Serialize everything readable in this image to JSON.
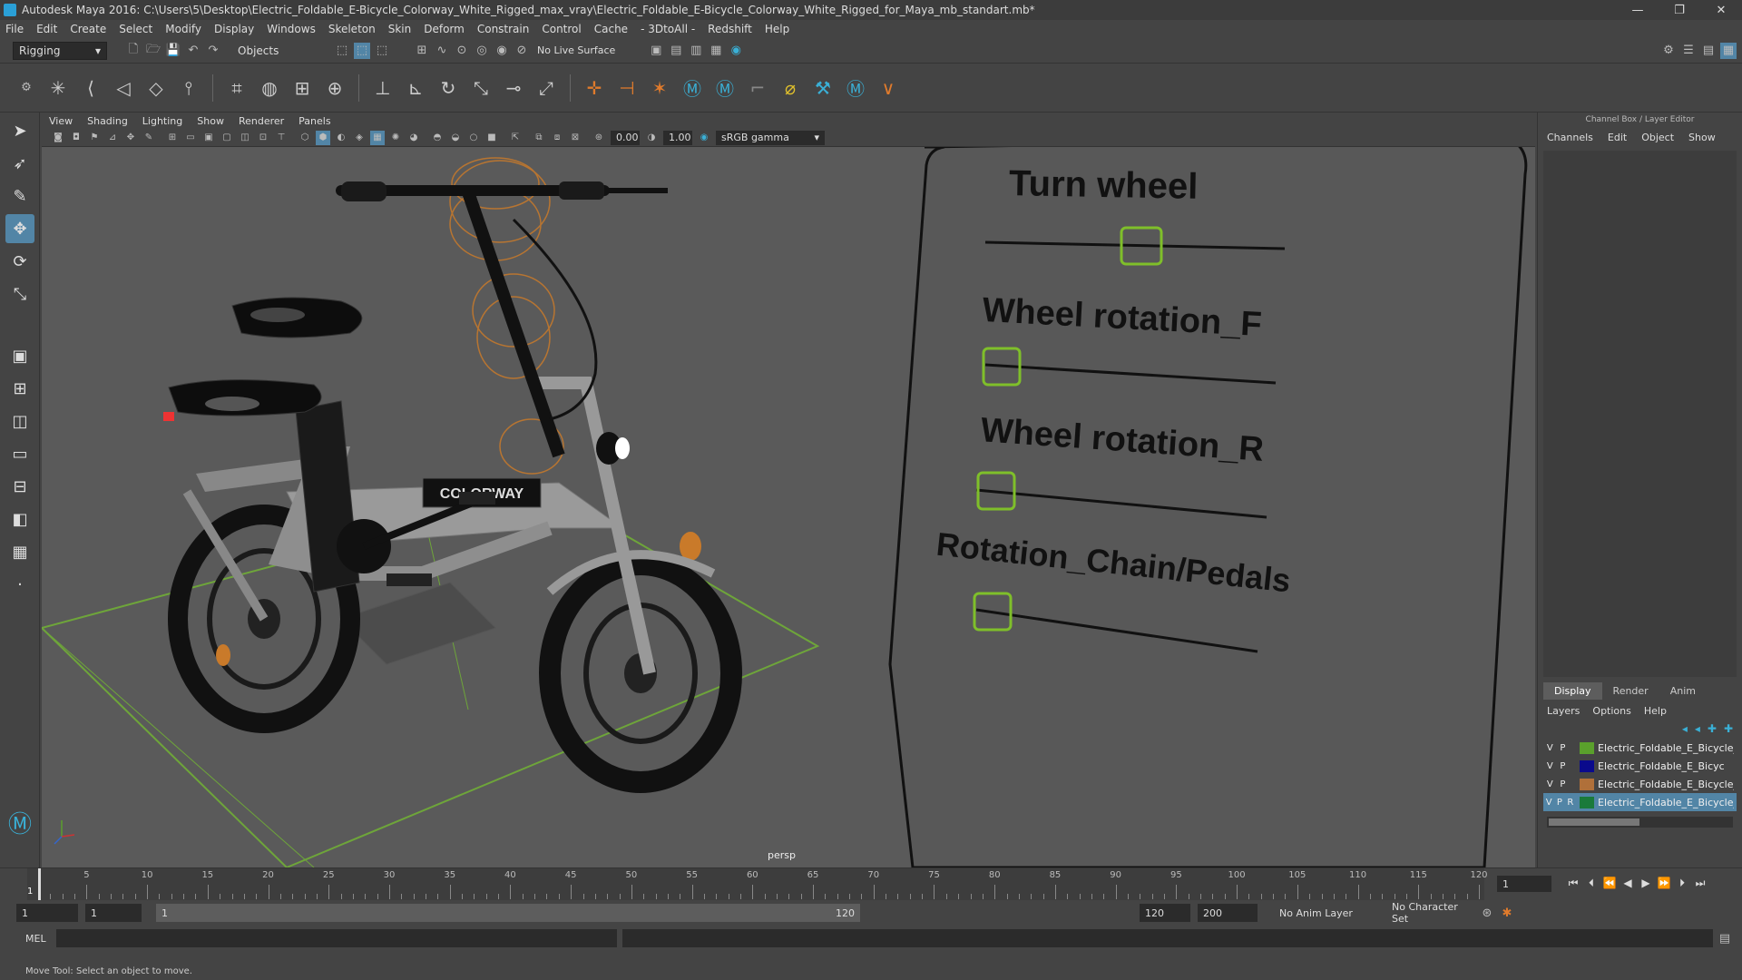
{
  "window": {
    "title": "Autodesk Maya 2016: C:\\Users\\5\\Desktop\\Electric_Foldable_E-Bicycle_Colorway_White_Rigged_max_vray\\Electric_Foldable_E-Bicycle_Colorway_White_Rigged_for_Maya_mb_standart.mb*",
    "minimize": "—",
    "maximize": "❐",
    "close": "✕"
  },
  "menubar": [
    "File",
    "Edit",
    "Create",
    "Select",
    "Modify",
    "Display",
    "Windows",
    "Skeleton",
    "Skin",
    "Deform",
    "Constrain",
    "Control",
    "Cache",
    "- 3DtoAll -",
    "Redshift",
    "Help"
  ],
  "statusline": {
    "menuset": "Rigging",
    "selection_mode": "Objects",
    "live_surface": "No Live Surface"
  },
  "viewport": {
    "menu": [
      "View",
      "Shading",
      "Lighting",
      "Show",
      "Renderer",
      "Panels"
    ],
    "near_value": "0.00",
    "far_value": "1.00",
    "color_space": "sRGB gamma",
    "camera_label": "persp",
    "control_board": {
      "labels": [
        "Turn wheel",
        "Wheel rotation_F",
        "Wheel rotation_R",
        "Rotation_Chain/Pedals"
      ]
    },
    "bike_logo_text": "COLORWAY"
  },
  "channel_box": {
    "title": "Channel Box / Layer Editor",
    "menu": [
      "Channels",
      "Edit",
      "Object",
      "Show"
    ]
  },
  "layer_editor": {
    "tabs": [
      "Display",
      "Render",
      "Anim"
    ],
    "active_tab": "Display",
    "menu": [
      "Layers",
      "Options",
      "Help"
    ],
    "layers": [
      {
        "v": "V",
        "p": "P",
        "r": "",
        "color": "#5aa02c",
        "name": "Electric_Foldable_E_Bicycle_C",
        "selected": false
      },
      {
        "v": "V",
        "p": "P",
        "r": "",
        "color": "#0a0a8c",
        "name": "Electric_Foldable_E_Bicyc",
        "selected": false
      },
      {
        "v": "V",
        "p": "P",
        "r": "",
        "color": "#b0703a",
        "name": "Electric_Foldable_E_Bicycle_C",
        "selected": false
      },
      {
        "v": "V",
        "p": "P",
        "r": "R",
        "color": "#1a7a3a",
        "name": "Electric_Foldable_E_Bicycle_C",
        "selected": true
      }
    ]
  },
  "timeline": {
    "ticks": [
      "5",
      "10",
      "15",
      "20",
      "25",
      "30",
      "35",
      "40",
      "45",
      "50",
      "55",
      "60",
      "65",
      "70",
      "75",
      "80",
      "85",
      "90",
      "95",
      "100",
      "105",
      "110",
      "115",
      "120"
    ],
    "current_frame": "1",
    "first_tick": "1"
  },
  "range": {
    "start": "1",
    "playback_start": "1",
    "slider_start": "1",
    "slider_end": "120",
    "playback_end": "120",
    "end": "200",
    "anim_layer": "No Anim Layer",
    "character_set": "No Character Set"
  },
  "command": {
    "label": "MEL"
  },
  "help_line": "Move Tool: Select an object to move."
}
